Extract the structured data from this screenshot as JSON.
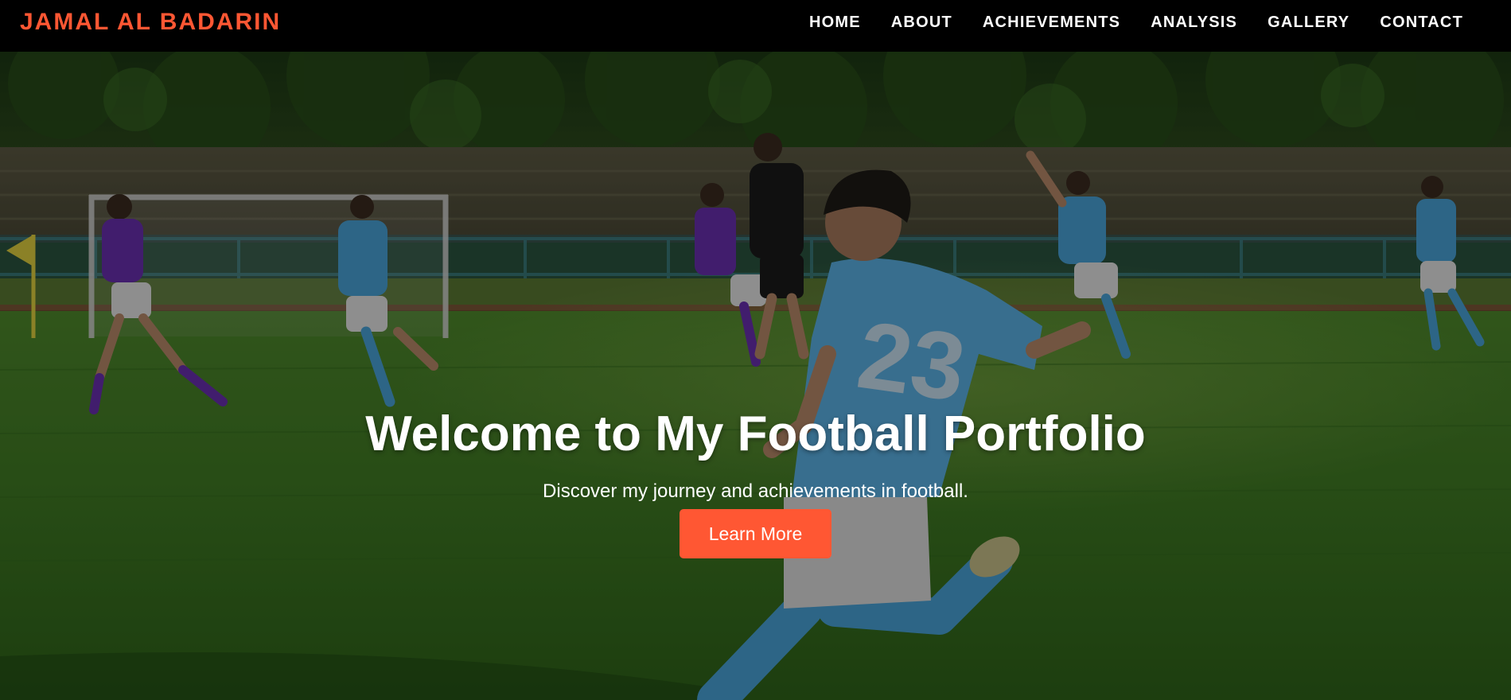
{
  "brand": {
    "name": "JAMAL AL BADARIN",
    "color": "#ff5733"
  },
  "nav": {
    "items": [
      {
        "label": "HOME"
      },
      {
        "label": "ABOUT"
      },
      {
        "label": "ACHIEVEMENTS"
      },
      {
        "label": "ANALYSIS"
      },
      {
        "label": "GALLERY"
      },
      {
        "label": "CONTACT"
      }
    ]
  },
  "hero": {
    "title": "Welcome to My Football Portfolio",
    "subtitle": "Discover my journey and achievements in football.",
    "cta_label": "Learn More",
    "jersey_number": "23",
    "accent_color": "#ff5733"
  }
}
